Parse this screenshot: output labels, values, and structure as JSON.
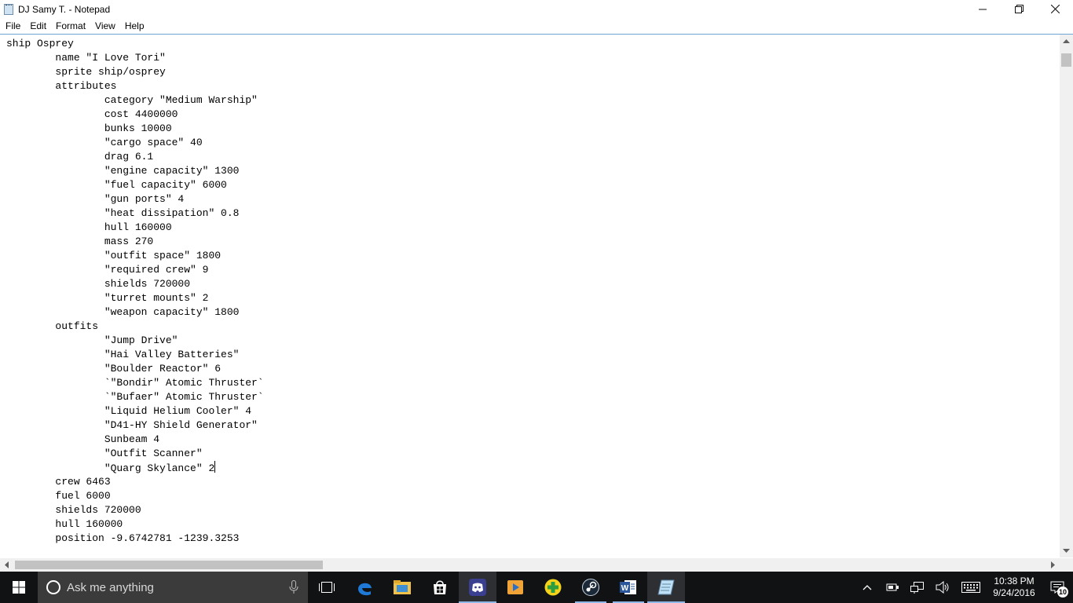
{
  "window": {
    "title": "DJ Samy T. - Notepad"
  },
  "menu": [
    "File",
    "Edit",
    "Format",
    "View",
    "Help"
  ],
  "editor": {
    "lines": [
      "ship Osprey",
      "\tname \"I Love Tori\"",
      "\tsprite ship/osprey",
      "\tattributes",
      "\t\tcategory \"Medium Warship\"",
      "\t\tcost 4400000",
      "\t\tbunks 10000",
      "\t\t\"cargo space\" 40",
      "\t\tdrag 6.1",
      "\t\t\"engine capacity\" 1300",
      "\t\t\"fuel capacity\" 6000",
      "\t\t\"gun ports\" 4",
      "\t\t\"heat dissipation\" 0.8",
      "\t\thull 160000",
      "\t\tmass 270",
      "\t\t\"outfit space\" 1800",
      "\t\t\"required crew\" 9",
      "\t\tshields 720000",
      "\t\t\"turret mounts\" 2",
      "\t\t\"weapon capacity\" 1800",
      "\toutfits",
      "\t\t\"Jump Drive\"",
      "\t\t\"Hai Valley Batteries\"",
      "\t\t\"Boulder Reactor\" 6",
      "\t\t`\"Bondir\" Atomic Thruster`",
      "\t\t`\"Bufaer\" Atomic Thruster`",
      "\t\t\"Liquid Helium Cooler\" 4",
      "\t\t\"D41-HY Shield Generator\"",
      "\t\tSunbeam 4",
      "\t\t\"Outfit Scanner\"",
      "\t\t\"Quarg Skylance\" 2",
      "\tcrew 6463",
      "\tfuel 6000",
      "\tshields 720000",
      "\thull 160000",
      "\tposition -9.6742781 -1239.3253"
    ],
    "caret_line": 30
  },
  "taskbar": {
    "search_placeholder": "Ask me anything",
    "apps": [
      {
        "name": "task-view-icon"
      },
      {
        "name": "edge-icon"
      },
      {
        "name": "file-explorer-icon"
      },
      {
        "name": "store-icon"
      },
      {
        "name": "discord-icon"
      },
      {
        "name": "media-player-icon"
      },
      {
        "name": "plus-app-icon"
      },
      {
        "name": "steam-icon"
      },
      {
        "name": "word-icon"
      },
      {
        "name": "notepad-icon"
      }
    ],
    "clock": {
      "time": "10:38 PM",
      "date": "9/24/2016"
    },
    "notification_count": "10"
  },
  "colors": {
    "taskbar_bg": "#111214",
    "search_bg": "#3b3b3b",
    "accent": "#8fb8e8",
    "edge_blue": "#1e7ad6",
    "discord_bg": "#3a3f8f",
    "word_blue": "#2b579a"
  }
}
